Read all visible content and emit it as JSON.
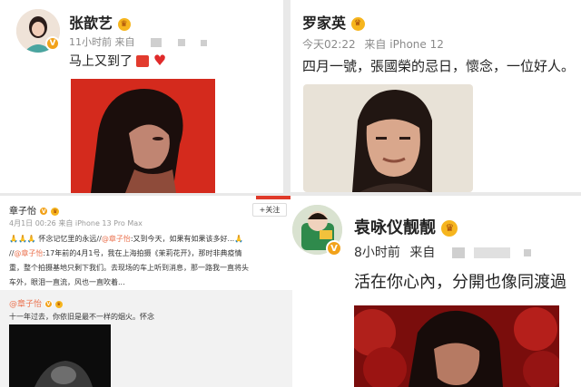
{
  "zhang": {
    "name": "张歆艺",
    "time": "11小时前",
    "from": "来自",
    "text": "马上又到了"
  },
  "luo": {
    "name": "罗家英",
    "time": "今天02:22",
    "from": "来自",
    "device": "iPhone 12",
    "text": "四月一號，張國榮的忌日，懷念，一位好人。"
  },
  "yuan": {
    "name": "袁咏仪靓靓",
    "time": "8小时前",
    "from": "来自",
    "text": "活在你心內，分開也像同渡過"
  },
  "zhangziyi": {
    "name": "章子怡",
    "meta": "4月1日 00:26 来自 iPhone 13 Pro Max",
    "follow": "+关注",
    "line1_a": "🙏🙏🙏 怀念记忆里的永远//",
    "line1_mention": "@章子怡",
    "line1_b": ":又到今天，如果有如果该多好...🙏",
    "line2_a": "//",
    "line2_mention": "@章子怡",
    "line2_b": ":17年前的4月1号，我在上海拍摄《茉莉花开》，那时非典疫情",
    "line3": "重，整个拍摄基地只剩下我们。去现场的车上听到消息，那一路我一直将头",
    "line4": "车外，眼泪一直流，风也一直吹着...",
    "repost_name": "@章子怡",
    "repost_text": "十一年过去，你依旧是最不一样的烟火。怀念"
  },
  "colors": {
    "accent_orange": "#eb7350",
    "verified_gold": "#f2a21a",
    "meta_gray": "#8a8a8a"
  }
}
